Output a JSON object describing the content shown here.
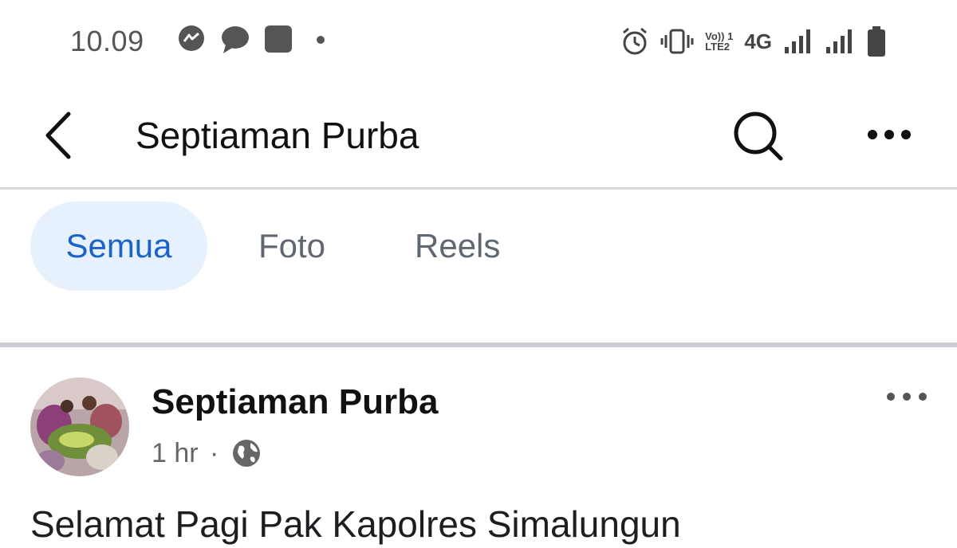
{
  "status_bar": {
    "time": "10.09",
    "left_icons": [
      "messenger-icon",
      "chat-bubble-icon",
      "app-square-icon",
      "notification-dot-icon"
    ],
    "network_label": "4G",
    "volte_label_top": "Vo)) 1",
    "volte_label_bottom": "LTE2",
    "right_icons": [
      "alarm-icon",
      "vibrate-icon",
      "volte-icon",
      "signal-1-icon",
      "signal-2-icon",
      "battery-icon"
    ]
  },
  "header": {
    "title": "Septiaman Purba",
    "icons": [
      "back-arrow-icon",
      "search-icon",
      "more-horizontal-icon"
    ]
  },
  "tabs": [
    {
      "label": "Semua",
      "active": true
    },
    {
      "label": "Foto",
      "active": false
    },
    {
      "label": "Reels",
      "active": false
    }
  ],
  "post": {
    "author": "Septiaman Purba",
    "time": "1 hr",
    "separator": "·",
    "privacy_icon": "globe-icon",
    "text": "Selamat Pagi Pak Kapolres Simalungun"
  },
  "colors": {
    "active_tab_bg": "#e7f1fd",
    "active_tab_text": "#1b63c9",
    "inactive_tab_text": "#606770",
    "divider": "#c9ccd1"
  }
}
